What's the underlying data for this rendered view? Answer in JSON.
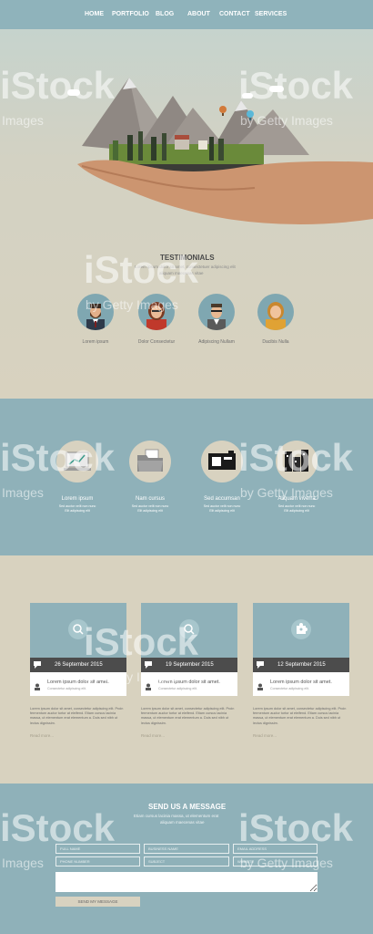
{
  "nav": {
    "items": [
      "HOME",
      "PORTFOLIO",
      "BLOG",
      "ABOUT",
      "CONTACT",
      "SERVICES"
    ]
  },
  "testimonials": {
    "title": "TESTIMONIALS",
    "subtitle_1": "Lorem ipsum dolor sit amet, consectetuer adipiscing elit",
    "subtitle_2": "aliquam maecenas vitae",
    "people": [
      {
        "name": "Lorem ipsum",
        "avatar": "man-beard-avatar"
      },
      {
        "name": "Dolor Consectetur",
        "avatar": "woman-red-avatar"
      },
      {
        "name": "Adipiscing Nullam",
        "avatar": "man-glasses-avatar"
      },
      {
        "name": "Dacibis Nulla",
        "avatar": "woman-blonde-avatar"
      }
    ]
  },
  "features": [
    {
      "title": "Lorem ipsum",
      "desc_1": "Sed auctor velit non nunc",
      "desc_2": "Elit adipiscing elit",
      "icon": "laptop-chart-icon"
    },
    {
      "title": "Nam cursus",
      "desc_1": "Sed auctor velit non nunc",
      "desc_2": "Elit adipiscing elit",
      "icon": "folder-icon"
    },
    {
      "title": "Sed accumsan",
      "desc_1": "Sed auctor velit non nunc",
      "desc_2": "Elit adipiscing elit",
      "icon": "camera-icon"
    },
    {
      "title": "Aliquam viverra",
      "desc_1": "Sed auctor velit non nunc",
      "desc_2": "Elit adipiscing elit",
      "icon": "cityscape-icon"
    }
  ],
  "blog": {
    "posts": [
      {
        "date": "26 September 2015",
        "title": "Lorem ipsum dolor sit amet.",
        "sub": "Consectetur adipiscing elit.",
        "text": "Lorem ipsum dolor sit amet, consectetur adipiscing elit. Proin fermentum auctor tortor at eleifend. Etiam cursus lacinia massa, ut elementum erat elementum a. Duis sed nibh ut lectus dignissim.",
        "more": "Read more...",
        "icon": "magnifier-icon"
      },
      {
        "date": "19 September 2015",
        "title": "Lorem ipsum dolor sit amet.",
        "sub": "Consectetur adipiscing elit.",
        "text": "Lorem ipsum dolor sit amet, consectetur adipiscing elit. Proin fermentum auctor tortor at eleifend. Etiam cursus lacinia massa, ut elementum erat elementum a. Duis sed nibh ut lectus dignissim.",
        "more": "Read more...",
        "icon": "magnifier-icon"
      },
      {
        "date": "12 September 2015",
        "title": "Lorem ipsum dolor sit amet.",
        "sub": "Consectetur adipiscing elit.",
        "text": "Lorem ipsum dolor sit amet, consectetur adipiscing elit. Proin fermentum auctor tortor at eleifend. Etiam cursus lacinia massa, ut elementum erat elementum a. Duis sed nibh ut lectus dignissim.",
        "more": "Read more...",
        "icon": "puzzle-icon"
      }
    ]
  },
  "contact": {
    "title": "SEND US A MESSAGE",
    "subtitle_1": "Etiam cursus lacinia massa, ut elementum erat",
    "subtitle_2": "aliquam maecenas vitae",
    "placeholders": {
      "full_name": "FULL NAME",
      "business_name": "BUSINESS NAME",
      "email": "EMAIL ADDRESS",
      "phone": "PHONE NUMBER",
      "subject": "SUBJECT",
      "website": "WEBSITE"
    },
    "send_label": "SEND MY MESSAGE"
  },
  "watermark": {
    "brand": "iStock",
    "images": "Images",
    "getty": "by Getty Images"
  },
  "colors": {
    "accent_blue": "#8fb1b9",
    "beige": "#d8d2c0",
    "dark_bar": "#4c4c4c"
  }
}
